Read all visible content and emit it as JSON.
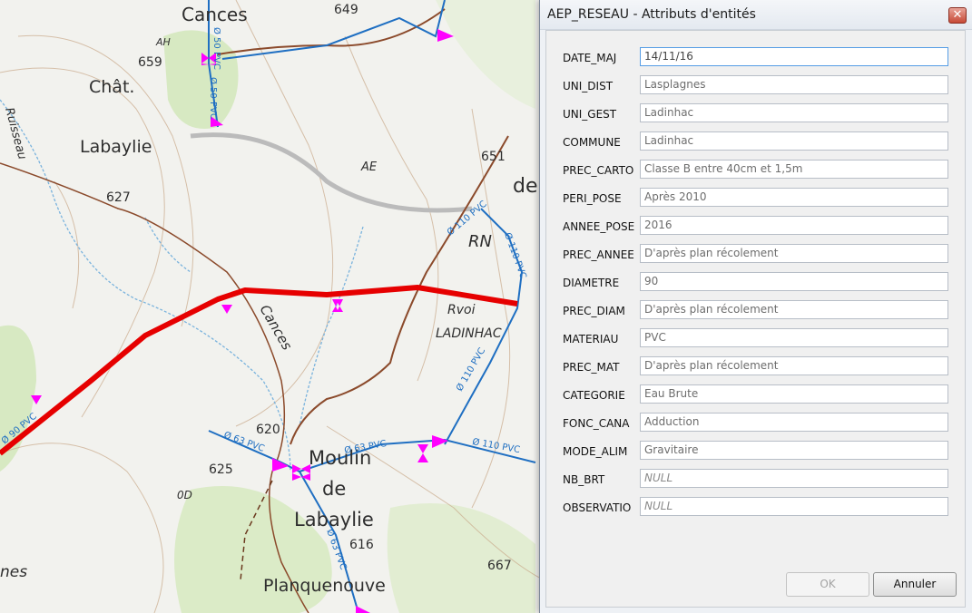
{
  "map": {
    "place_labels": [
      "Cances",
      "Chât.",
      "Labaylie",
      "AE",
      "de",
      "RN",
      "Rvoi",
      "LADINHAC",
      "Cances",
      "Moulin",
      "de",
      "Labaylie",
      "Planquenouve",
      "nes",
      "0D",
      "Ruisseau"
    ],
    "elevations": [
      "649",
      "659",
      "627",
      "651",
      "620",
      "625",
      "616",
      "667",
      "AH"
    ],
    "pipe_labels": [
      "Ø 50 PVC",
      "Ø 50 PVC",
      "Ø 110 PVC",
      "Ø 110 PVC",
      "Ø 110 PVC",
      "Ø 110 PVC",
      "Ø 63 PVC",
      "Ø 63 PVC",
      "Ø 63 PVC",
      "Ø 90 PVC"
    ],
    "colors": {
      "network_pipe": "#1f6fc2",
      "selected_pipe": "#e60000",
      "valve": "#ff00ff",
      "road": "#8b4a2b"
    }
  },
  "dialog": {
    "title": "AEP_RESEAU - Attributs d'entités",
    "close_label": "✕",
    "fields": [
      {
        "label": "DATE_MAJ",
        "value": "14/11/16"
      },
      {
        "label": "UNI_DIST",
        "value": "Lasplagnes"
      },
      {
        "label": "UNI_GEST",
        "value": "Ladinhac"
      },
      {
        "label": "COMMUNE",
        "value": "Ladinhac"
      },
      {
        "label": "PREC_CARTO",
        "value": "Classe B entre 40cm et 1,5m"
      },
      {
        "label": "PERI_POSE",
        "value": "Après 2010"
      },
      {
        "label": "ANNEE_POSE",
        "value": "2016"
      },
      {
        "label": "PREC_ANNEE",
        "value": "D'après plan récolement"
      },
      {
        "label": "DIAMETRE",
        "value": "90"
      },
      {
        "label": "PREC_DIAM",
        "value": "D'après plan récolement"
      },
      {
        "label": "MATERIAU",
        "value": "PVC"
      },
      {
        "label": "PREC_MAT",
        "value": "D'après plan récolement"
      },
      {
        "label": "CATEGORIE",
        "value": "Eau Brute"
      },
      {
        "label": "FONC_CANA",
        "value": "Adduction"
      },
      {
        "label": "MODE_ALIM",
        "value": "Gravitaire"
      },
      {
        "label": "NB_BRT",
        "value": "NULL"
      },
      {
        "label": "OBSERVATIO",
        "value": "NULL"
      }
    ],
    "ok_label": "OK",
    "cancel_label": "Annuler"
  }
}
